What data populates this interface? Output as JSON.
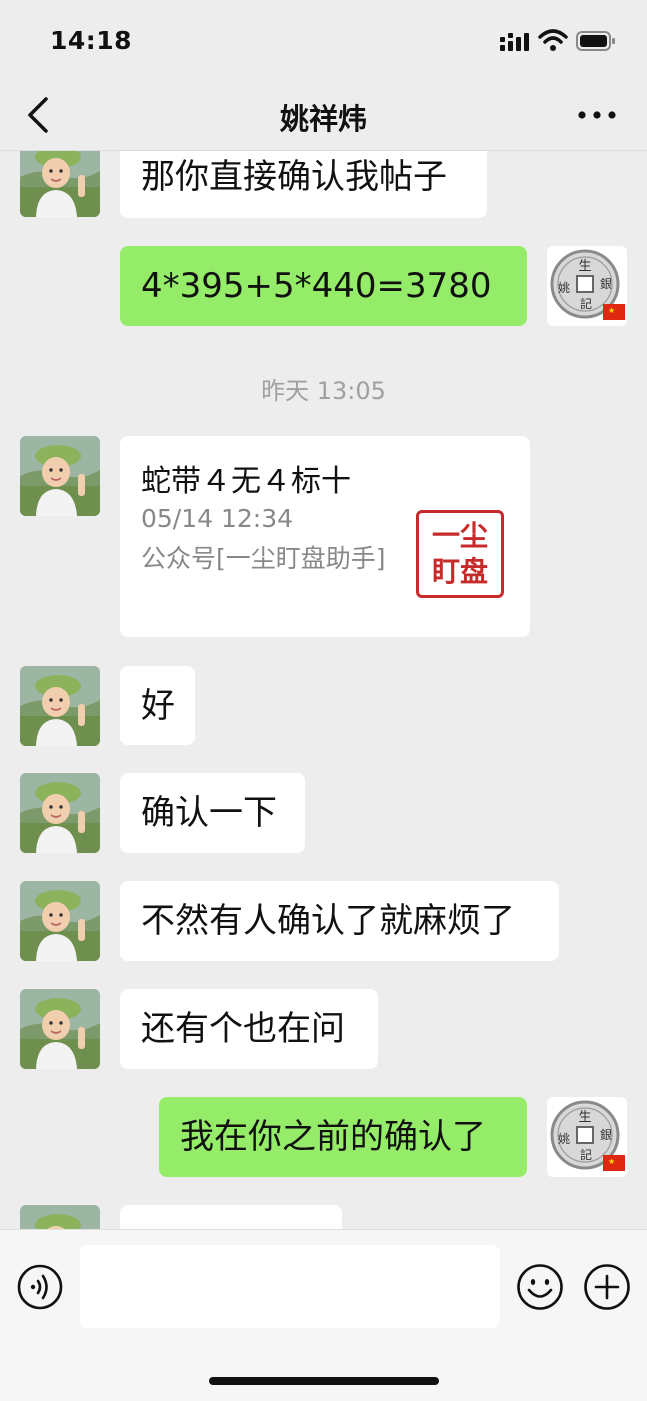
{
  "status_bar": {
    "time": "14:18"
  },
  "header": {
    "title": "姚祥炜"
  },
  "messages": [
    {
      "side": "in",
      "text": "那你直接确认我帖子"
    },
    {
      "side": "out",
      "text": "4*395+5*440=3780"
    },
    {
      "timestamp": "昨天 13:05"
    },
    {
      "side": "in",
      "type": "card",
      "title": "蛇带４无４标十",
      "date": "05/14 12:34",
      "source": "公众号[一尘盯盘助手]",
      "logo_line1": "一尘",
      "logo_line2": "盯盘"
    },
    {
      "side": "in",
      "text": "好"
    },
    {
      "side": "in",
      "text": "确认一下"
    },
    {
      "side": "in",
      "text": "不然有人确认了就麻烦了"
    },
    {
      "side": "in",
      "text": "还有个也在问"
    },
    {
      "side": "out",
      "text": "我在你之前的确认了"
    }
  ],
  "my_avatar_seal": {
    "chars": [
      "生",
      "銀",
      "姚",
      "記"
    ],
    "flag_color": "#de2910"
  },
  "colors": {
    "out_bubble": "#95ec69",
    "in_bubble": "#ffffff",
    "background": "#ededed"
  }
}
